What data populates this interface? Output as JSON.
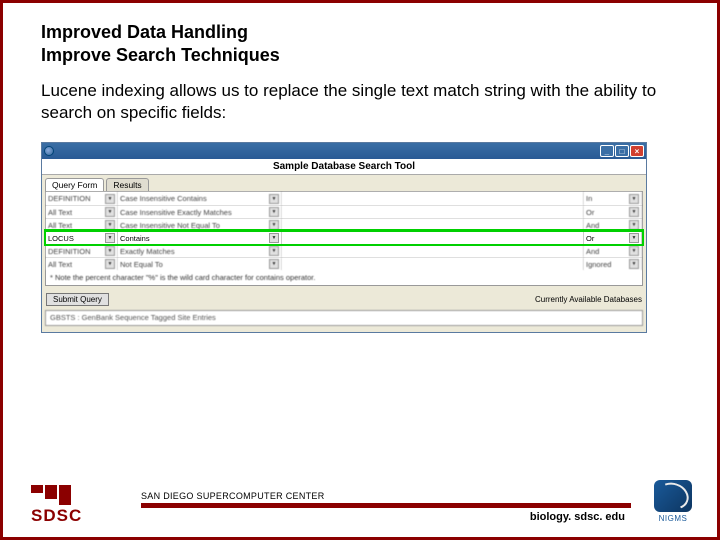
{
  "slide": {
    "title_line1": "Improved Data Handling",
    "title_line2": "Improve Search Techniques",
    "body": "Lucene indexing allows us to replace the single text match string with the ability to search on specific fields:"
  },
  "app": {
    "window_title": "",
    "caption": "Sample Database Search Tool",
    "win_buttons": {
      "min": "_",
      "max": "□",
      "close": "×"
    },
    "tabs": [
      {
        "label": "Query Form",
        "active": true
      },
      {
        "label": "Results",
        "active": false
      }
    ],
    "rows": [
      {
        "field": "DEFINITION",
        "op": "Case Insensitive Contains",
        "val": "",
        "conn": "In"
      },
      {
        "field": "All Text",
        "op": "Case Insensitive Exactly Matches",
        "val": "",
        "conn": "Or"
      },
      {
        "field": "All Text",
        "op": "Case Insensitive Not Equal To",
        "val": "",
        "conn": "And"
      },
      {
        "field": "LOCUS",
        "op": "Contains",
        "val": "",
        "conn": "Or",
        "highlight": true
      },
      {
        "field": "DEFINITION",
        "op": "Exactly Matches",
        "val": "",
        "conn": "And"
      },
      {
        "field": "All Text",
        "op": "Not Equal To",
        "val": "",
        "conn": "Ignored"
      }
    ],
    "note": "* Note the percent character \"%\" is the wild card character for contains operator.",
    "submit_label": "Submit Query",
    "databases_label": "Currently Available Databases",
    "database_entry": "GBSTS : GenBank Sequence Tagged Site Entries"
  },
  "footer": {
    "logo_text": "SDSC",
    "caption": "SAN DIEGO SUPERCOMPUTER CENTER",
    "url": "biology. sdsc. edu",
    "nigms": "NIGMS"
  }
}
